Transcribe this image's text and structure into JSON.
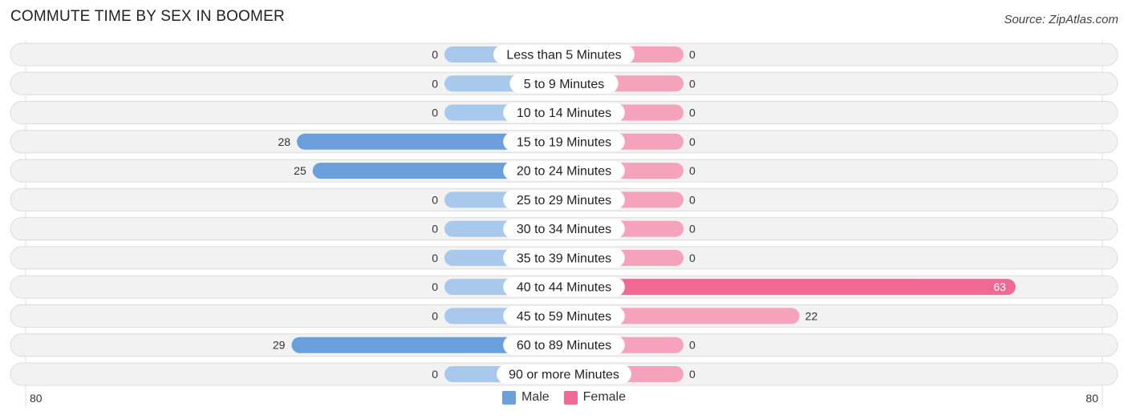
{
  "header": {
    "title": "COMMUTE TIME BY SEX IN BOOMER",
    "source": "Source: ZipAtlas.com"
  },
  "axis": {
    "left_label": "80",
    "right_label": "80"
  },
  "legend": [
    {
      "label": "Male",
      "color": "#6a9fdc"
    },
    {
      "label": "Female",
      "color": "#f06894"
    }
  ],
  "colors": {
    "male": "#6a9fdc",
    "male_light": "#a8c8ec",
    "female": "#f06894",
    "female_light": "#f5a3bd",
    "row_bg": "#f2f2f2"
  },
  "chart_data": {
    "type": "bar",
    "orientation": "horizontal-diverging",
    "title": "COMMUTE TIME BY SEX IN BOOMER",
    "xlim": [
      -80,
      80
    ],
    "tick_labels": [
      "80",
      "80"
    ],
    "legend_position": "bottom-center",
    "categories": [
      "Less than 5 Minutes",
      "5 to 9 Minutes",
      "10 to 14 Minutes",
      "15 to 19 Minutes",
      "20 to 24 Minutes",
      "25 to 29 Minutes",
      "30 to 34 Minutes",
      "35 to 39 Minutes",
      "40 to 44 Minutes",
      "45 to 59 Minutes",
      "60 to 89 Minutes",
      "90 or more Minutes"
    ],
    "series": [
      {
        "name": "Male",
        "values": [
          0,
          0,
          0,
          28,
          25,
          0,
          0,
          0,
          0,
          0,
          29,
          0
        ]
      },
      {
        "name": "Female",
        "values": [
          0,
          0,
          0,
          0,
          0,
          0,
          0,
          0,
          63,
          22,
          0,
          0
        ]
      }
    ]
  }
}
